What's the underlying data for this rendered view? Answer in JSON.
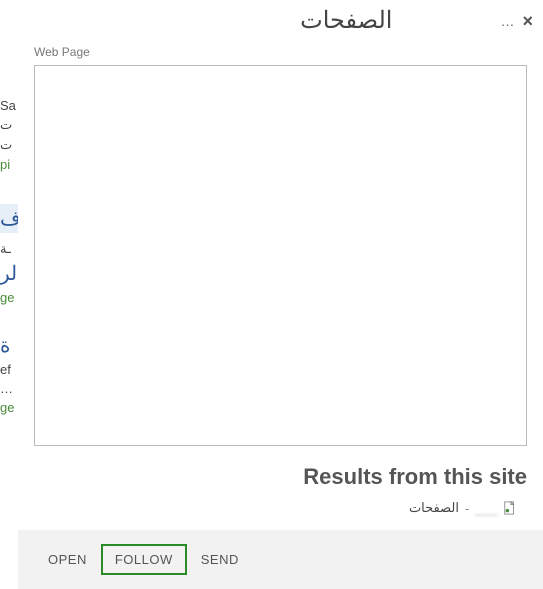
{
  "dialog": {
    "title": "الصفحات",
    "close_glyph": "×",
    "menu_glyph": "…"
  },
  "preview": {
    "label": "Web Page"
  },
  "results": {
    "heading": "Results from this site",
    "item": {
      "text": "الصفحات",
      "separator": " - ",
      "blurred_host": "___"
    }
  },
  "actions": {
    "open": "OPEN",
    "follow": "FOLLOW",
    "send": "SEND"
  },
  "bg": {
    "s1": "Sa",
    "s2": "ت",
    "s3": "ت",
    "s4": "pi",
    "s5": "ف",
    "s6": "ـة",
    "s7": "الر",
    "s8": "ge",
    "s9": "ة",
    "s10": "ef",
    "s11": "…",
    "s12": "ge"
  }
}
